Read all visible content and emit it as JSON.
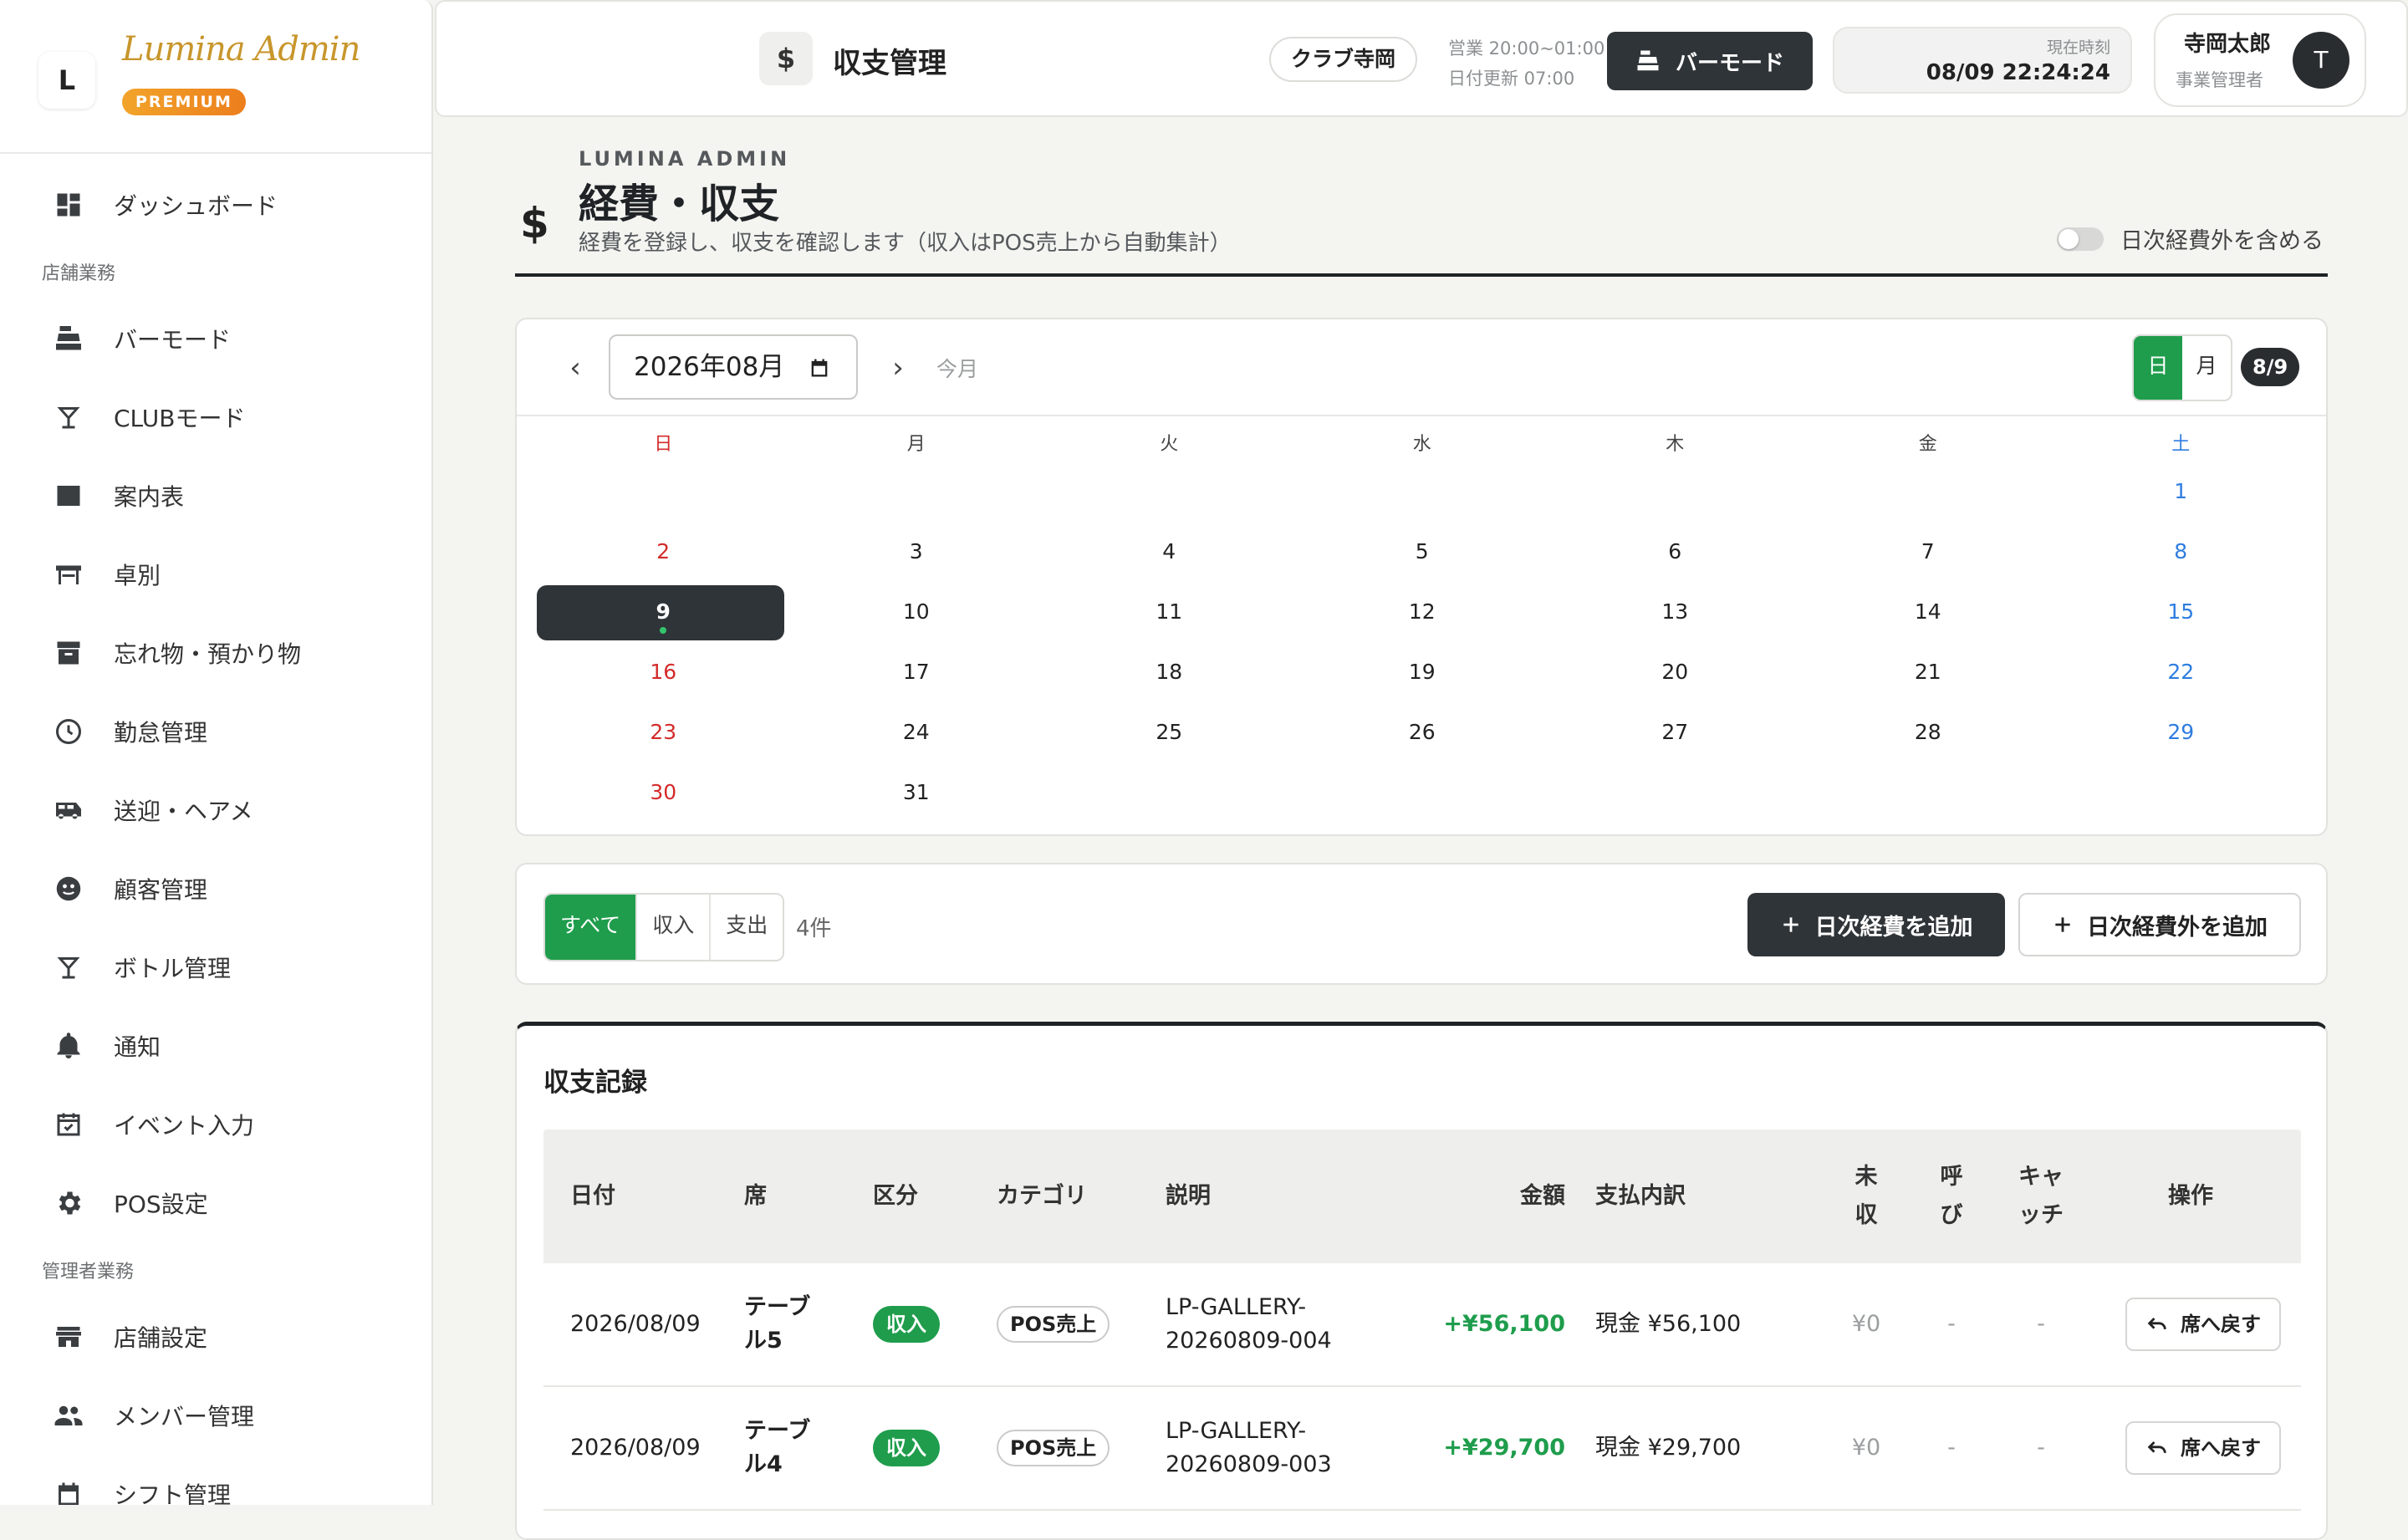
{
  "brand": {
    "mark": "L",
    "name": "Lumina Admin",
    "badge": "PREMIUM"
  },
  "sidebar": {
    "items_top": [
      {
        "label": "ダッシュボード",
        "icon": "dashboard-icon"
      }
    ],
    "section_store": "店舗業務",
    "items_store": [
      {
        "label": "バーモード",
        "icon": "cash-register-icon"
      },
      {
        "label": "CLUBモード",
        "icon": "cocktail-icon"
      },
      {
        "label": "案内表",
        "icon": "checklist-icon"
      },
      {
        "label": "卓別",
        "icon": "table-icon"
      },
      {
        "label": "忘れ物・預かり物",
        "icon": "archive-icon"
      },
      {
        "label": "勤怠管理",
        "icon": "clock-icon"
      },
      {
        "label": "送迎・ヘアメ",
        "icon": "bus-icon"
      },
      {
        "label": "顧客管理",
        "icon": "face-icon"
      },
      {
        "label": "ボトル管理",
        "icon": "cocktail-icon"
      },
      {
        "label": "通知",
        "icon": "bell-icon"
      },
      {
        "label": "イベント入力",
        "icon": "calendar-check-icon"
      },
      {
        "label": "POS設定",
        "icon": "gear-icon"
      }
    ],
    "section_admin": "管理者業務",
    "items_admin": [
      {
        "label": "店舗設定",
        "icon": "store-icon"
      },
      {
        "label": "メンバー管理",
        "icon": "people-icon"
      },
      {
        "label": "シフト管理",
        "icon": "calendar-icon"
      }
    ]
  },
  "header": {
    "title_icon": "$",
    "title": "収支管理",
    "store": "クラブ寺岡",
    "hours": "営業 20:00~01:00",
    "date_update": "日付更新 07:00",
    "bar_mode": "バーモード",
    "clock_label": "現在時刻",
    "clock_time": "08/09 22:24:24",
    "user_name": "寺岡太郎",
    "user_role": "事業管理者",
    "avatar": "T"
  },
  "page": {
    "icon": "$",
    "eyebrow": "LUMINA ADMIN",
    "title": "経費・収支",
    "subtitle": "経費を登録し、収支を確認します（収入はPOS売上から自動集計）",
    "toggle_label": "日次経費外を含める",
    "toggle_on": false
  },
  "calendar": {
    "month_value": "2026年08月",
    "today_label": "今月",
    "view_day": "日",
    "view_month": "月",
    "selected_chip": "8/9",
    "weekdays": [
      "日",
      "月",
      "火",
      "水",
      "木",
      "金",
      "土"
    ],
    "weeks": [
      [
        "",
        "",
        "",
        "",
        "",
        "",
        "1"
      ],
      [
        "2",
        "3",
        "4",
        "5",
        "6",
        "7",
        "8"
      ],
      [
        "9",
        "10",
        "11",
        "12",
        "13",
        "14",
        "15"
      ],
      [
        "16",
        "17",
        "18",
        "19",
        "20",
        "21",
        "22"
      ],
      [
        "23",
        "24",
        "25",
        "26",
        "27",
        "28",
        "29"
      ],
      [
        "30",
        "31",
        "",
        "",
        "",
        "",
        ""
      ]
    ],
    "selected_day": "9"
  },
  "filter": {
    "all": "すべて",
    "income": "収入",
    "expense": "支出",
    "count": "4件",
    "add_daily": "日次経費を追加",
    "add_non_daily": "日次経費外を追加"
  },
  "records": {
    "title": "収支記録",
    "headers": {
      "date": "日付",
      "seat": "席",
      "type": "区分",
      "category": "カテゴリ",
      "desc": "説明",
      "amount": "金額",
      "payment": "支払内訳",
      "unpaid": "未\n収",
      "call": "呼\nび",
      "catch": "キャ\nッチ",
      "ops": "操作"
    },
    "rows": [
      {
        "date": "2026/08/09",
        "seat": "テーブ\nル5",
        "type": "収入",
        "category": "POS売上",
        "desc": "LP-GALLERY-\n20260809-004",
        "amount": "+¥56,100",
        "payment": "現金 ¥56,100",
        "unpaid": "¥0",
        "call": "-",
        "catch": "-",
        "action": "席へ戻す"
      },
      {
        "date": "2026/08/09",
        "seat": "テーブ\nル4",
        "type": "収入",
        "category": "POS売上",
        "desc": "LP-GALLERY-\n20260809-003",
        "amount": "+¥29,700",
        "payment": "現金 ¥29,700",
        "unpaid": "¥0",
        "call": "-",
        "catch": "-",
        "action": "席へ戻す"
      }
    ]
  },
  "colors": {
    "accent": "#1f9d4c",
    "dark": "#2f3438",
    "sunday": "#d32b2b",
    "saturday": "#2f7de0",
    "brand_gold": "#c8962c"
  }
}
